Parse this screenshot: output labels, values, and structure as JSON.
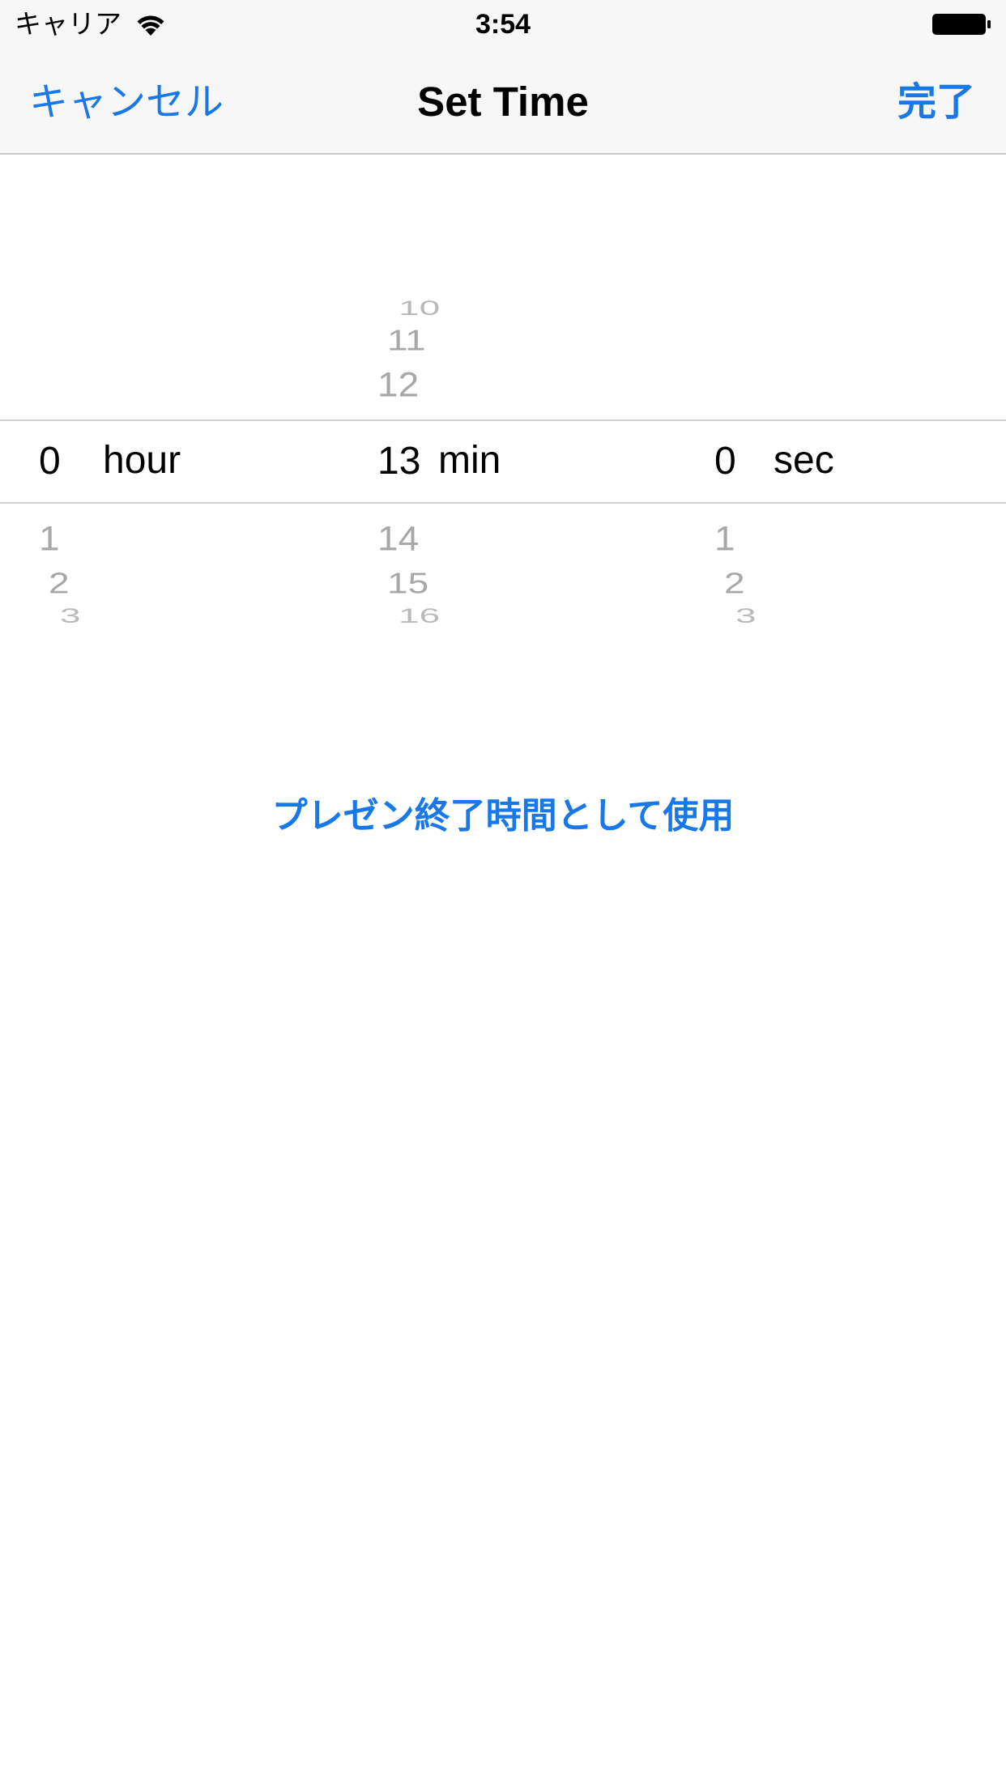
{
  "status_bar": {
    "carrier": "キャリア",
    "time": "3:54",
    "icons": [
      "wifi-icon",
      "battery-icon"
    ]
  },
  "nav_bar": {
    "cancel_label": "キャンセル",
    "title": "Set Time",
    "done_label": "完了"
  },
  "picker": {
    "hour": {
      "unit": "hour",
      "items": [
        "0",
        "1",
        "2",
        "3"
      ],
      "selected": "0"
    },
    "minute": {
      "unit": "min",
      "items": [
        "10",
        "11",
        "12",
        "13",
        "14",
        "15",
        "16"
      ],
      "selected": "13"
    },
    "second": {
      "unit": "sec",
      "items": [
        "0",
        "1",
        "2",
        "3"
      ],
      "selected": "0"
    }
  },
  "action": {
    "label": "プレゼン終了時間として使用"
  },
  "colors": {
    "accent": "#1878e8",
    "bar_background": "#f7f7f7",
    "picker_dim": "#a8a8ab"
  }
}
